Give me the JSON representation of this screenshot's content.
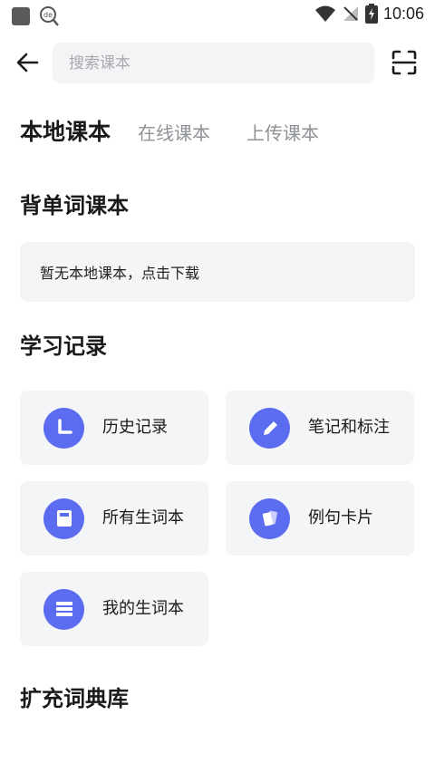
{
  "status_bar": {
    "time": "10:06"
  },
  "search": {
    "placeholder": "搜索课本"
  },
  "tabs": [
    {
      "label": "本地课本",
      "active": true
    },
    {
      "label": "在线课本",
      "active": false
    },
    {
      "label": "上传课本",
      "active": false
    }
  ],
  "sections": {
    "wordbooks": {
      "title": "背单词课本",
      "empty_text": "暂无本地课本，点击下载"
    },
    "records": {
      "title": "学习记录",
      "items": [
        {
          "label": "历史记录",
          "icon": "clock-icon"
        },
        {
          "label": "笔记和标注",
          "icon": "pencil-icon"
        },
        {
          "label": "所有生词本",
          "icon": "notebook-icon"
        },
        {
          "label": "例句卡片",
          "icon": "cards-icon"
        },
        {
          "label": "我的生词本",
          "icon": "list-icon"
        }
      ]
    },
    "dictionaries": {
      "title": "扩充词典库"
    }
  },
  "colors": {
    "accent": "#5b6cf0",
    "card_bg": "#f4f5f7"
  }
}
